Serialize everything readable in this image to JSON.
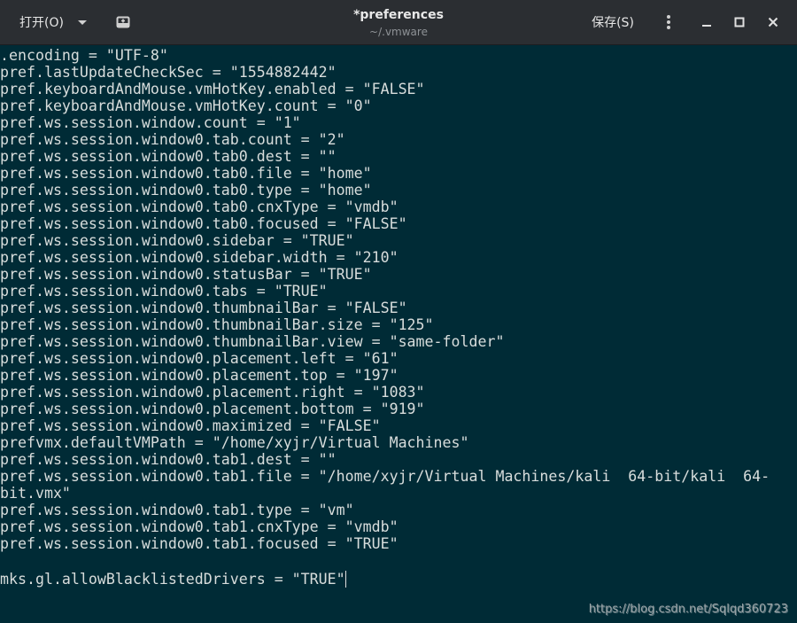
{
  "headerbar": {
    "open_label": "打开(O)",
    "title": "*preferences",
    "subtitle": "~/.vmware",
    "save_label": "保存(S)",
    "menu_icon": "⋮",
    "minimize_icon": "–",
    "maximize_icon": "□",
    "close_icon": "✕"
  },
  "editor": {
    "lines": [
      ".encoding = \"UTF-8\"",
      "pref.lastUpdateCheckSec = \"1554882442\"",
      "pref.keyboardAndMouse.vmHotKey.enabled = \"FALSE\"",
      "pref.keyboardAndMouse.vmHotKey.count = \"0\"",
      "pref.ws.session.window.count = \"1\"",
      "pref.ws.session.window0.tab.count = \"2\"",
      "pref.ws.session.window0.tab0.dest = \"\"",
      "pref.ws.session.window0.tab0.file = \"home\"",
      "pref.ws.session.window0.tab0.type = \"home\"",
      "pref.ws.session.window0.tab0.cnxType = \"vmdb\"",
      "pref.ws.session.window0.tab0.focused = \"FALSE\"",
      "pref.ws.session.window0.sidebar = \"TRUE\"",
      "pref.ws.session.window0.sidebar.width = \"210\"",
      "pref.ws.session.window0.statusBar = \"TRUE\"",
      "pref.ws.session.window0.tabs = \"TRUE\"",
      "pref.ws.session.window0.thumbnailBar = \"FALSE\"",
      "pref.ws.session.window0.thumbnailBar.size = \"125\"",
      "pref.ws.session.window0.thumbnailBar.view = \"same-folder\"",
      "pref.ws.session.window0.placement.left = \"61\"",
      "pref.ws.session.window0.placement.top = \"197\"",
      "pref.ws.session.window0.placement.right = \"1083\"",
      "pref.ws.session.window0.placement.bottom = \"919\"",
      "pref.ws.session.window0.maximized = \"FALSE\"",
      "prefvmx.defaultVMPath = \"/home/xyjr/Virtual Machines\"",
      "pref.ws.session.window0.tab1.dest = \"\"",
      "pref.ws.session.window0.tab1.file = \"/home/xyjr/Virtual Machines/kali  64-bit/kali  64-",
      "bit.vmx\"",
      "pref.ws.session.window0.tab1.type = \"vm\"",
      "pref.ws.session.window0.tab1.cnxType = \"vmdb\"",
      "pref.ws.session.window0.tab1.focused = \"TRUE\"",
      "",
      "mks.gl.allowBlacklistedDrivers = \"TRUE\""
    ]
  },
  "watermark": "https://blog.csdn.net/Sqlqd360723"
}
